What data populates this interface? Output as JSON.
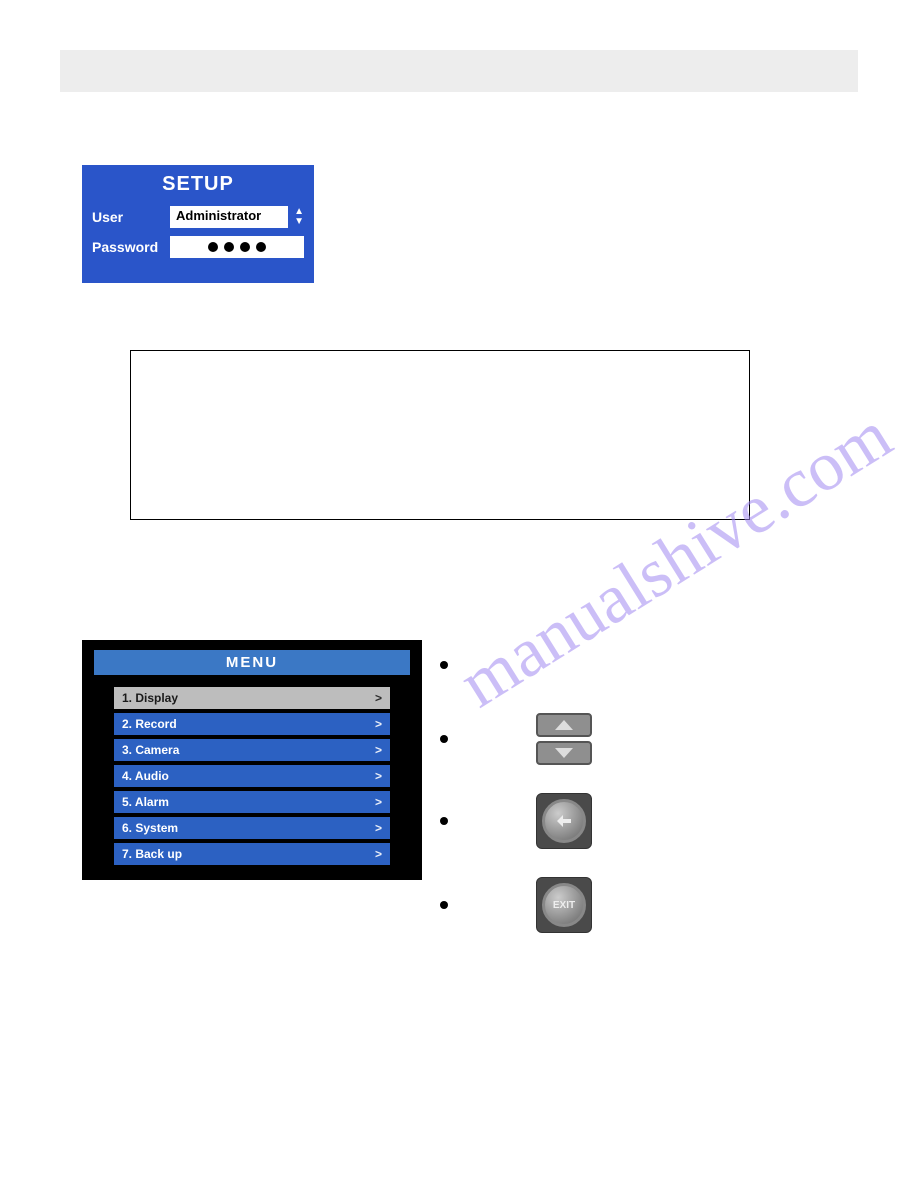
{
  "setup": {
    "title": "SETUP",
    "user_label": "User",
    "user_value": "Administrator",
    "password_label": "Password",
    "password_dots": 4
  },
  "watermark": "manualshive.com",
  "menu": {
    "title": "MENU",
    "items": [
      {
        "label": "1. Display",
        "selected": true
      },
      {
        "label": "2. Record",
        "selected": false
      },
      {
        "label": "3. Camera",
        "selected": false
      },
      {
        "label": "4. Audio",
        "selected": false
      },
      {
        "label": "5. Alarm",
        "selected": false
      },
      {
        "label": "6. System",
        "selected": false
      },
      {
        "label": "7. Back up",
        "selected": false
      }
    ]
  },
  "right_icons": {
    "up_down": "up-down-arrow-buttons",
    "enter": "enter-button",
    "exit_label": "EXIT"
  }
}
